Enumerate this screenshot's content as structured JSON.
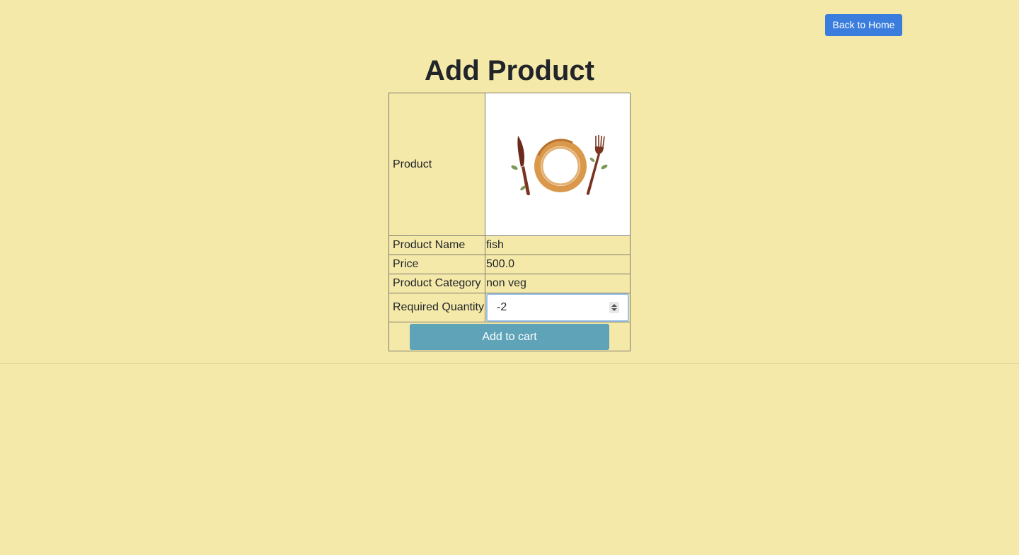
{
  "header": {
    "back_label": "Back to Home"
  },
  "page_title": "Add Product",
  "product": {
    "image_label": "Product",
    "image_icon": "plate-knife-fork-icon",
    "rows": [
      {
        "label": "Product Name",
        "value": "fish"
      },
      {
        "label": "Price",
        "value": "500.0"
      },
      {
        "label": "Product Category",
        "value": "non veg"
      }
    ],
    "quantity_label": "Required Quantity",
    "quantity_value": "-2",
    "add_to_cart_label": "Add to cart"
  },
  "colors": {
    "background": "#f5e9a9",
    "back_button": "#3b7ddd",
    "cart_button": "#5ea3b8"
  }
}
